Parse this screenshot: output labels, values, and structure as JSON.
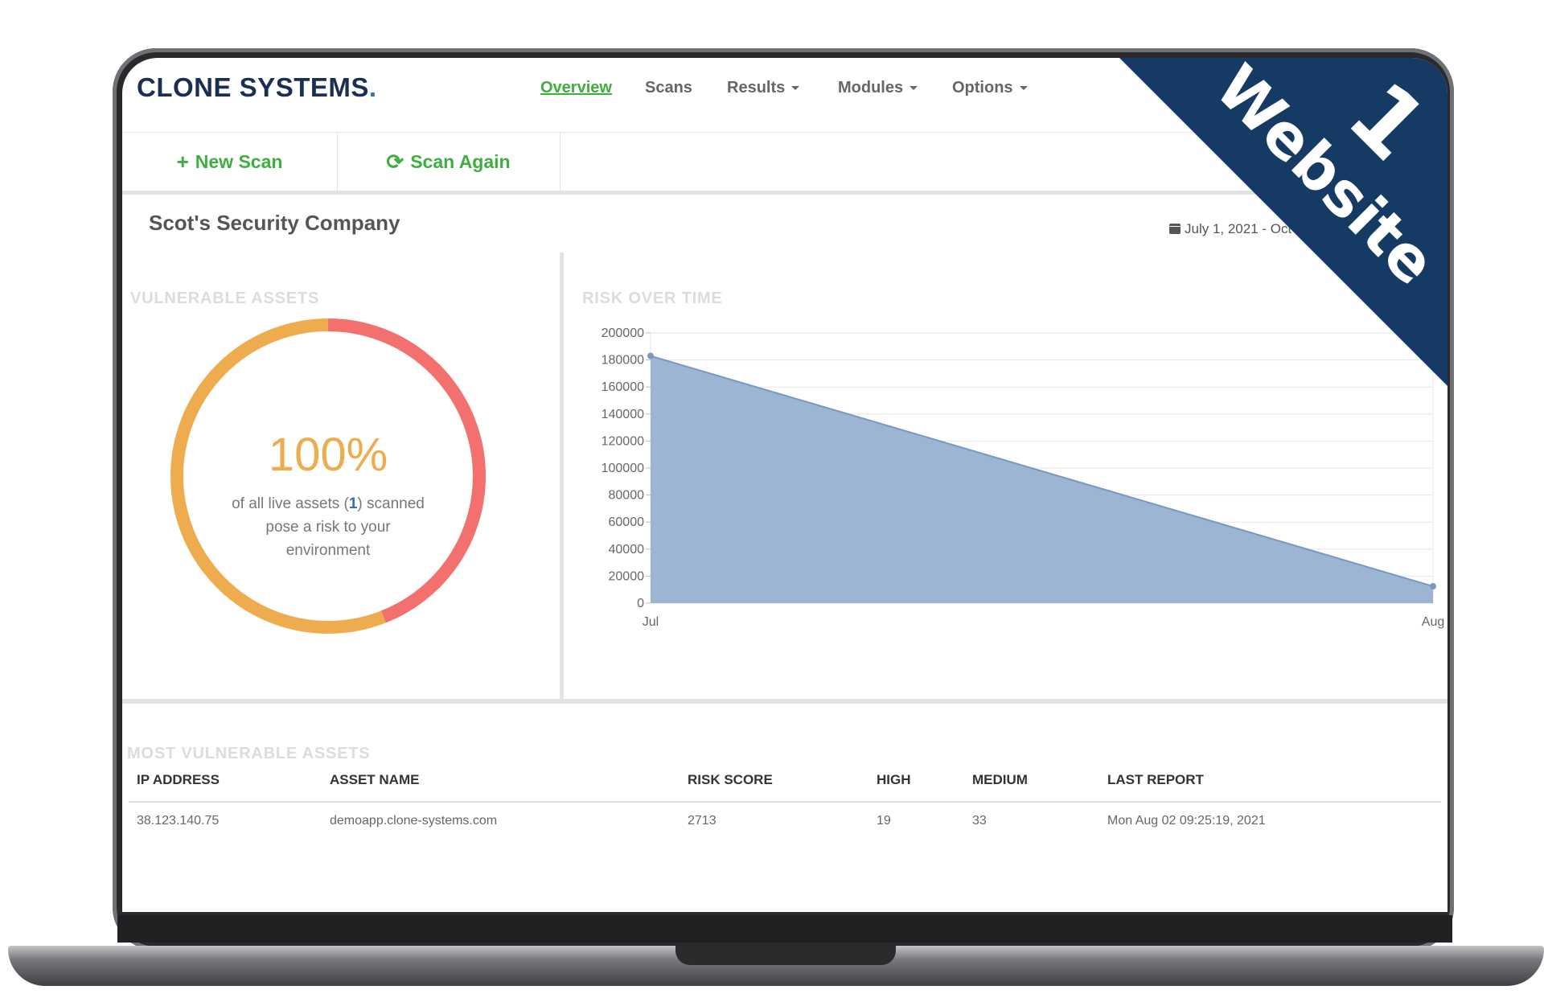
{
  "app": {
    "logo_text": "CLONE SYSTEMS",
    "logo_dot": "."
  },
  "nav": {
    "items": [
      {
        "label": "Overview",
        "active": true,
        "dropdown": false
      },
      {
        "label": "Scans",
        "active": false,
        "dropdown": false
      },
      {
        "label": "Results",
        "active": false,
        "dropdown": true
      },
      {
        "label": "Modules",
        "active": false,
        "dropdown": true
      },
      {
        "label": "Options",
        "active": false,
        "dropdown": true
      }
    ]
  },
  "toolbar": {
    "new_scan_icon": "+",
    "new_scan_label": "New Scan",
    "scan_again_icon": "⟳",
    "scan_again_label": "Scan Again"
  },
  "page": {
    "company": "Scot's Security Company",
    "date_range": "July 1, 2021 - Oct"
  },
  "vulnerable_assets": {
    "title": "VULNERABLE ASSETS",
    "percent_text": "100%",
    "caption_pre": "of all live assets (",
    "caption_count": "1",
    "caption_mid": ") scanned",
    "caption_line2": "pose a risk to your",
    "caption_line3": "environment",
    "ring_colors": {
      "orange": "#efac4e",
      "red": "#f2716f"
    },
    "ring_split_percent": 44
  },
  "risk_over_time": {
    "title": "RISK OVER TIME"
  },
  "chart_data": {
    "type": "area",
    "categories": [
      "Jul",
      "Aug"
    ],
    "values": [
      183000,
      12500
    ],
    "ylim": [
      0,
      200000
    ],
    "yticks": [
      "200000",
      "180000",
      "160000",
      "140000",
      "120000",
      "100000",
      "80000",
      "60000",
      "40000",
      "20000",
      "0"
    ],
    "fill_color": "#9bb5d3",
    "line_color": "#7897c2",
    "grid": true
  },
  "most_vulnerable": {
    "title": "MOST VULNERABLE ASSETS",
    "columns": [
      "IP ADDRESS",
      "ASSET NAME",
      "RISK SCORE",
      "HIGH",
      "MEDIUM",
      "LAST REPORT"
    ],
    "rows": [
      [
        "38.123.140.75",
        "demoapp.clone-systems.com",
        "2713",
        "19",
        "33",
        "Mon Aug 02 09:25:19, 2021"
      ]
    ]
  },
  "banner": {
    "number": "1",
    "word": "Website",
    "color": "#153a63"
  }
}
